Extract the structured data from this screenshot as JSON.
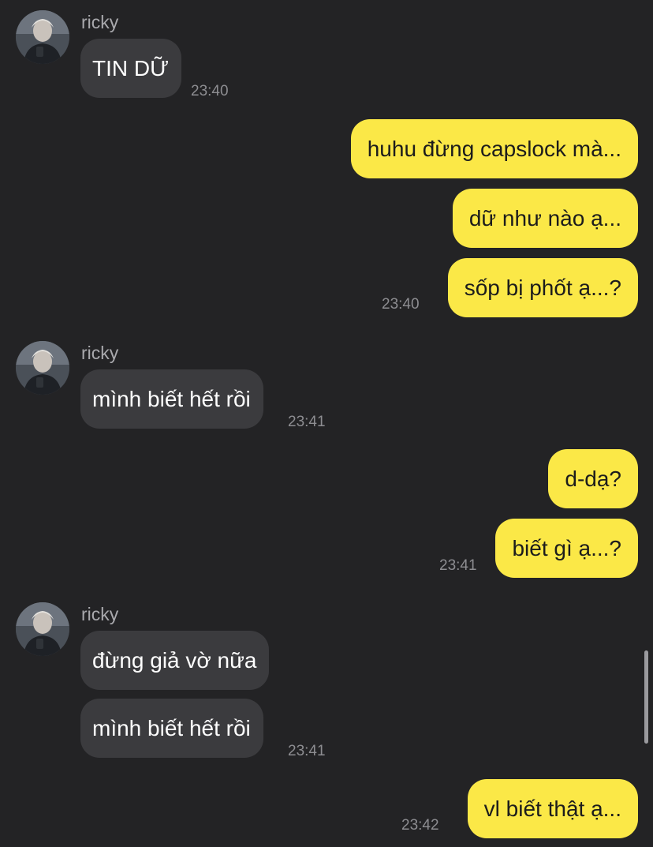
{
  "colors": {
    "background": "#232325",
    "incoming_bubble": "#3b3b3e",
    "outgoing_bubble": "#fbe847",
    "timestamp": "#8d8d91",
    "sender_name": "#a9a9ad"
  },
  "conversation": {
    "groups": [
      {
        "sender": "ricky",
        "direction": "incoming",
        "messages": [
          "TIN DỮ"
        ],
        "time": "23:40"
      },
      {
        "direction": "outgoing",
        "messages": [
          "huhu đừng capslock mà...",
          "dữ như nào ạ...",
          "sốp bị phốt ạ...?"
        ],
        "time": "23:40"
      },
      {
        "sender": "ricky",
        "direction": "incoming",
        "messages": [
          "mình biết hết rồi"
        ],
        "time": "23:41"
      },
      {
        "direction": "outgoing",
        "messages": [
          "d-dạ?",
          "biết gì ạ...?"
        ],
        "time": "23:41"
      },
      {
        "sender": "ricky",
        "direction": "incoming",
        "messages": [
          "đừng giả vờ nữa",
          "mình biết hết rồi"
        ],
        "time": "23:41"
      },
      {
        "direction": "outgoing",
        "messages": [
          "vl biết thật ạ..."
        ],
        "time": "23:42"
      }
    ]
  }
}
